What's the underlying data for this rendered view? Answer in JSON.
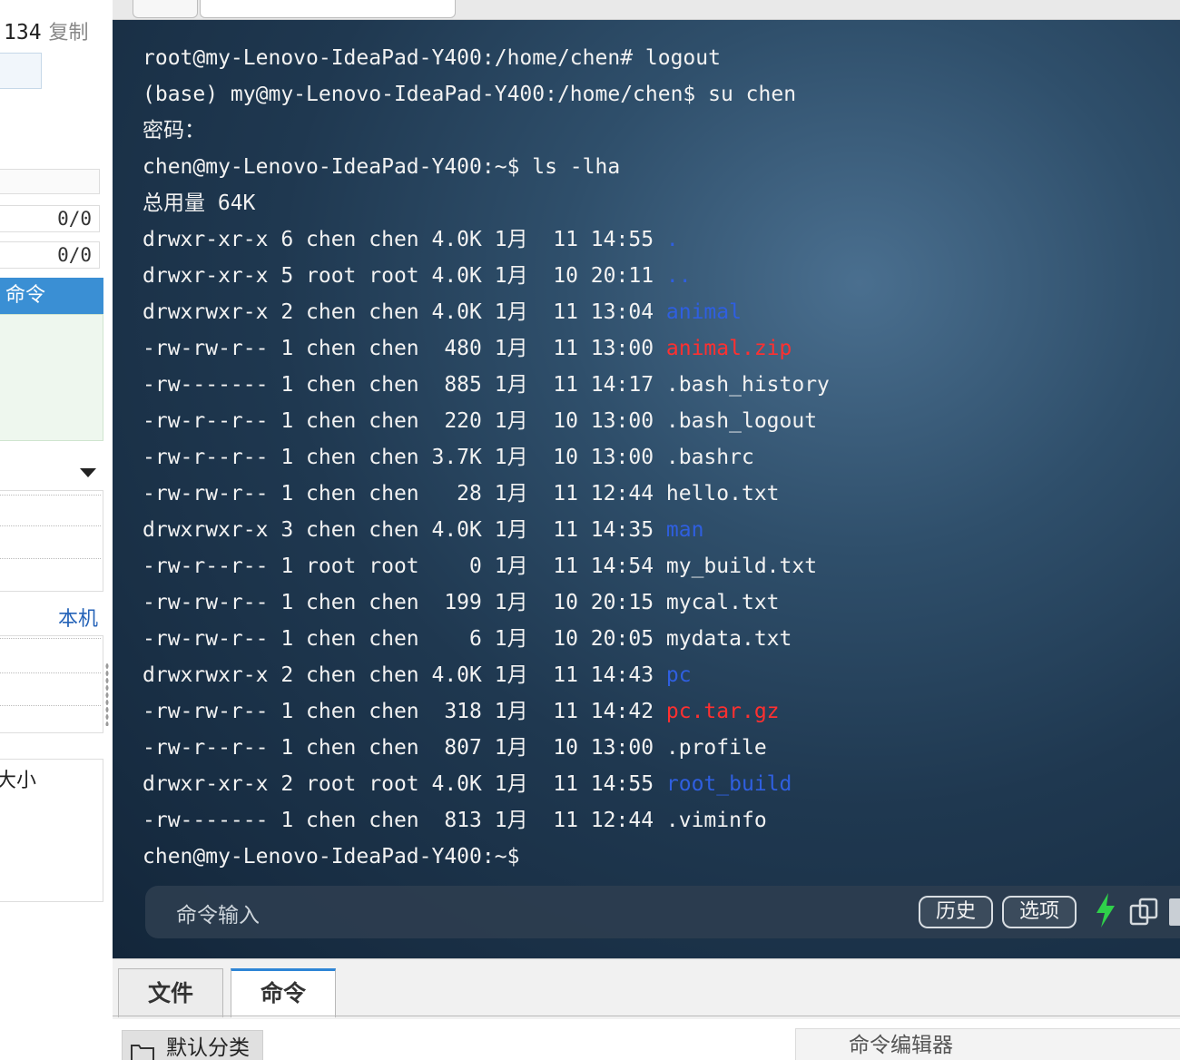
{
  "sidebar": {
    "ip_fragment": "134",
    "copy_label": "复制",
    "upload_count": "0/0",
    "download_count": "0/0",
    "command_header": "命令",
    "local_label": "本机",
    "size_label": "大小"
  },
  "terminal": {
    "lines": [
      "root@my-Lenovo-IdeaPad-Y400:/home/chen# logout",
      "(base) my@my-Lenovo-IdeaPad-Y400:/home/chen$ su chen",
      "密码：",
      "chen@my-Lenovo-IdeaPad-Y400:~$ ls -lha",
      "总用量 64K"
    ],
    "listing": [
      {
        "prefix": "drwxr-xr-x 6 chen chen 4.0K 1月  11 14:55 ",
        "name": ".",
        "kind": "dir"
      },
      {
        "prefix": "drwxr-xr-x 5 root root 4.0K 1月  10 20:11 ",
        "name": "..",
        "kind": "dir"
      },
      {
        "prefix": "drwxrwxr-x 2 chen chen 4.0K 1月  11 13:04 ",
        "name": "animal",
        "kind": "dir"
      },
      {
        "prefix": "-rw-rw-r-- 1 chen chen  480 1月  11 13:00 ",
        "name": "animal.zip",
        "kind": "zip"
      },
      {
        "prefix": "-rw------- 1 chen chen  885 1月  11 14:17 ",
        "name": ".bash_history",
        "kind": "file"
      },
      {
        "prefix": "-rw-r--r-- 1 chen chen  220 1月  10 13:00 ",
        "name": ".bash_logout",
        "kind": "file"
      },
      {
        "prefix": "-rw-r--r-- 1 chen chen 3.7K 1月  10 13:00 ",
        "name": ".bashrc",
        "kind": "file"
      },
      {
        "prefix": "-rw-rw-r-- 1 chen chen   28 1月  11 12:44 ",
        "name": "hello.txt",
        "kind": "file"
      },
      {
        "prefix": "drwxrwxr-x 3 chen chen 4.0K 1月  11 14:35 ",
        "name": "man",
        "kind": "dir"
      },
      {
        "prefix": "-rw-r--r-- 1 root root    0 1月  11 14:54 ",
        "name": "my_build.txt",
        "kind": "file"
      },
      {
        "prefix": "-rw-rw-r-- 1 chen chen  199 1月  10 20:15 ",
        "name": "mycal.txt",
        "kind": "file"
      },
      {
        "prefix": "-rw-rw-r-- 1 chen chen    6 1月  10 20:05 ",
        "name": "mydata.txt",
        "kind": "file"
      },
      {
        "prefix": "drwxrwxr-x 2 chen chen 4.0K 1月  11 14:43 ",
        "name": "pc",
        "kind": "dir"
      },
      {
        "prefix": "-rw-rw-r-- 1 chen chen  318 1月  11 14:42 ",
        "name": "pc.tar.gz",
        "kind": "zip"
      },
      {
        "prefix": "-rw-r--r-- 1 chen chen  807 1月  10 13:00 ",
        "name": ".profile",
        "kind": "file"
      },
      {
        "prefix": "drwxr-xr-x 2 root root 4.0K 1月  11 14:55 ",
        "name": "root_build",
        "kind": "dir"
      },
      {
        "prefix": "-rw------- 1 chen chen  813 1月  11 12:44 ",
        "name": ".viminfo",
        "kind": "file"
      }
    ],
    "prompt": "chen@my-Lenovo-IdeaPad-Y400:~$"
  },
  "command_bar": {
    "placeholder": "命令输入",
    "history_label": "历史",
    "options_label": "选项"
  },
  "bottom_panel": {
    "tabs": [
      "文件",
      "命令"
    ],
    "category_label": "默认分类",
    "editor_label": "命令编辑器"
  },
  "colors": {
    "dir": "#2f5fe0",
    "archive": "#ff3030",
    "accent": "#2f86d6",
    "status_dot": "#2db84d"
  }
}
